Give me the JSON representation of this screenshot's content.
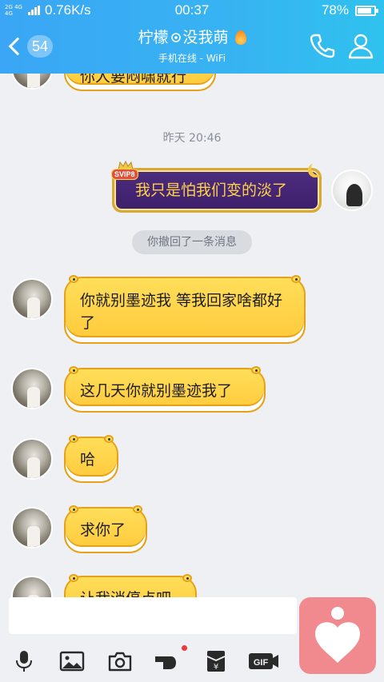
{
  "status_bar": {
    "network": "2G 4G 4G",
    "speed": "0.76K/s",
    "time": "00:37",
    "battery": "78%",
    "battery_level": 0.78
  },
  "header": {
    "unread_count": "54",
    "chat_name_part1": "柠檬",
    "chat_name_part2": "没我萌",
    "status": "手机在线 - WiFi"
  },
  "messages": {
    "prev_partial": "你人要闷啸就行",
    "time_label": "昨天 20:46",
    "svip_tag": "SVIP8",
    "my_message": "我只是怕我们变的淡了",
    "recall_notice": "你撤回了一条消息",
    "msg1": "你就别墨迹我 等我回家啥都好了",
    "msg2": "这几天你就别墨迹我了",
    "msg3": "哈",
    "msg4": "求你了",
    "msg5_partial": "让我消停点吧"
  },
  "colors": {
    "header_gradient_start": "#3aa6f5",
    "header_gradient_end": "#2fc2ee",
    "bubble_yellow": "#ffd04a",
    "svip_purple": "#3d1f6b",
    "background": "#eef0f4"
  },
  "toolbar": {
    "icons": [
      "microphone-icon",
      "image-icon",
      "camera-icon",
      "hongbao-gesture-icon",
      "red-packet-icon",
      "gif-icon",
      "more-icon"
    ]
  }
}
